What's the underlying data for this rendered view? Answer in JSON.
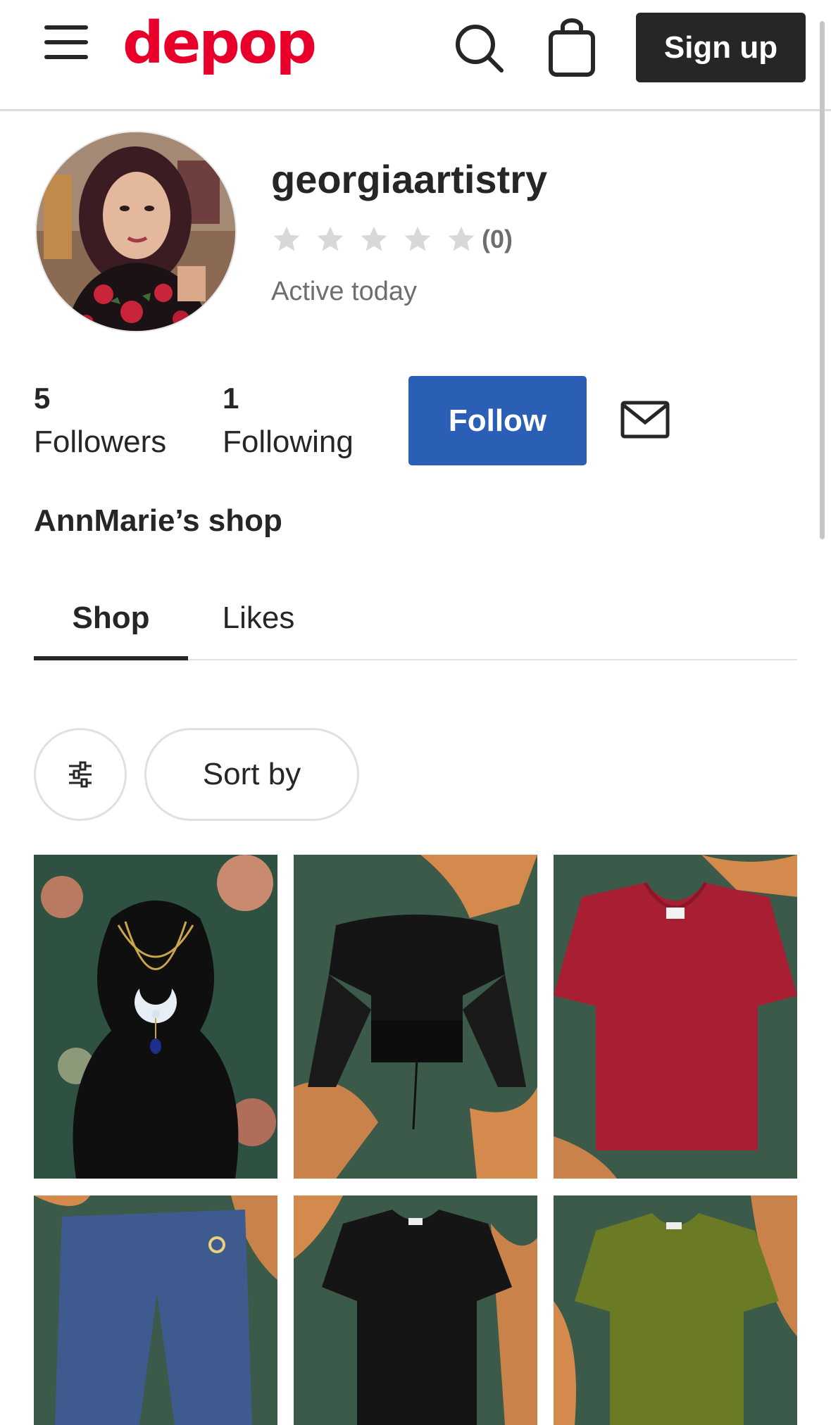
{
  "header": {
    "logo_text": "depop",
    "signup_label": "Sign up",
    "brand_color": "#e8002a",
    "icons": [
      "hamburger-menu-icon",
      "search-icon",
      "shopping-bag-icon"
    ]
  },
  "profile": {
    "username": "georgiaartistry",
    "rating_count": "(0)",
    "rating_stars": 0,
    "active_status": "Active today",
    "followers_count": "5",
    "followers_label": "Followers",
    "following_count": "1",
    "following_label": "Following",
    "follow_label": "Follow",
    "follow_color": "#2b5fb5",
    "shop_name": "AnnMarie’s shop"
  },
  "tabs": [
    {
      "label": "Shop",
      "active": true
    },
    {
      "label": "Likes",
      "active": false
    }
  ],
  "filters": {
    "sort_label": "Sort by",
    "filter_icon": "sliders-icon"
  },
  "products": [
    {
      "item": "necklace",
      "color": "#111111"
    },
    {
      "item": "black-top",
      "color": "#1b1b1b"
    },
    {
      "item": "red-tee",
      "color": "#a81e33"
    },
    {
      "item": "jeans",
      "color": "#3e5a8f"
    },
    {
      "item": "black-dress",
      "color": "#151515"
    },
    {
      "item": "olive-tee",
      "color": "#6b7a24"
    }
  ]
}
